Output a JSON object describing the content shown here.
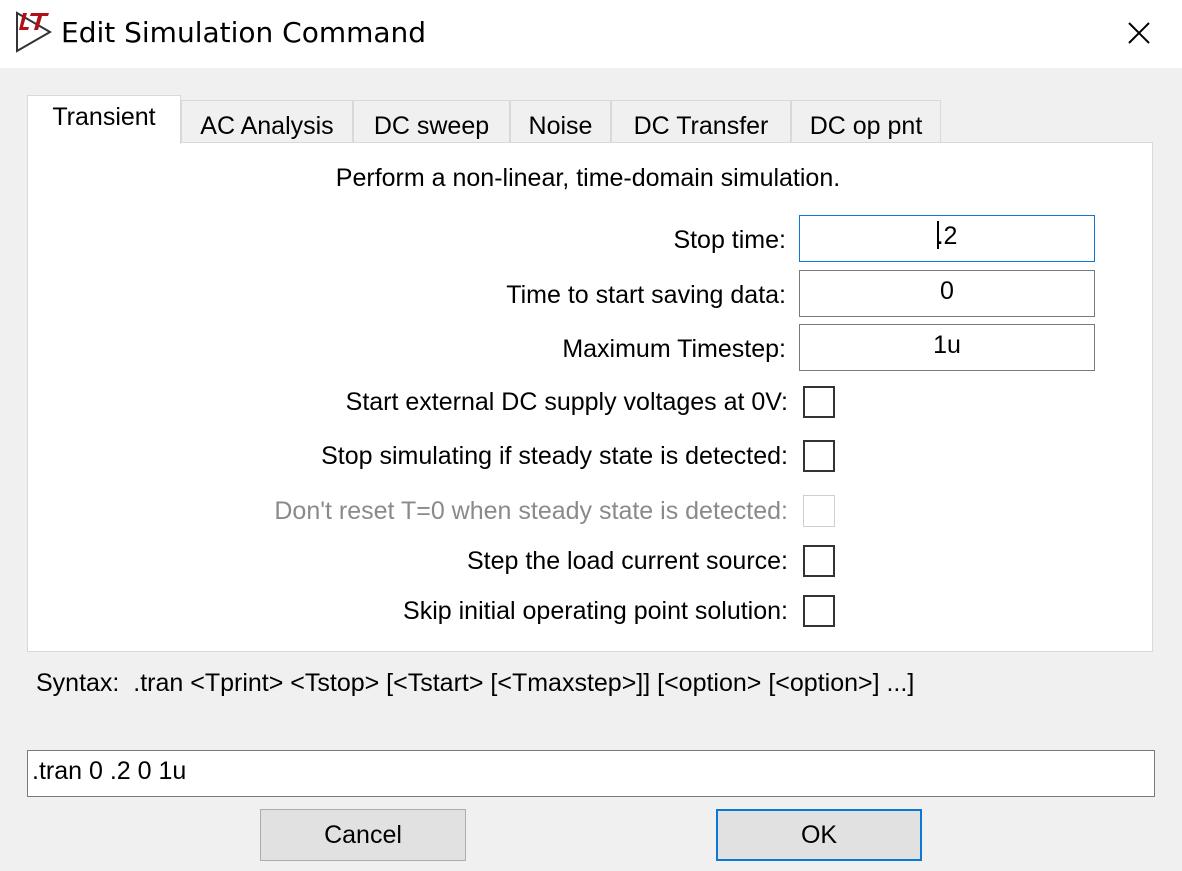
{
  "window": {
    "title": "Edit Simulation Command",
    "icon": "ltspice-logo-icon",
    "close_icon": "close-icon"
  },
  "tabs": [
    {
      "label": "Transient",
      "active": true
    },
    {
      "label": "AC Analysis",
      "active": false
    },
    {
      "label": "DC sweep",
      "active": false
    },
    {
      "label": "Noise",
      "active": false
    },
    {
      "label": "DC Transfer",
      "active": false
    },
    {
      "label": "DC op pnt",
      "active": false
    }
  ],
  "transient": {
    "description": "Perform a non-linear, time-domain simulation.",
    "fields": [
      {
        "label": "Stop time:",
        "value": ".2",
        "focused": true
      },
      {
        "label": "Time to start saving data:",
        "value": "0",
        "focused": false
      },
      {
        "label": "Maximum Timestep:",
        "value": "1u",
        "focused": false
      }
    ],
    "checkboxes": [
      {
        "label": "Start external DC supply voltages at 0V:",
        "checked": false,
        "enabled": true
      },
      {
        "label": "Stop simulating if steady state is detected:",
        "checked": false,
        "enabled": true
      },
      {
        "label": "Don't reset T=0 when steady state is detected:",
        "checked": false,
        "enabled": false
      },
      {
        "label": "Step the load current source:",
        "checked": false,
        "enabled": true
      },
      {
        "label": "Skip initial operating point solution:",
        "checked": false,
        "enabled": true
      }
    ]
  },
  "syntax": "Syntax:  .tran <Tprint> <Tstop> [<Tstart> [<Tmaxstep>]] [<option> [<option>] ...]",
  "command": ".tran 0 .2 0 1u",
  "buttons": {
    "cancel": "Cancel",
    "ok": "OK"
  },
  "colors": {
    "focus_border": "#0a78d4",
    "disabled_text": "#8a8a8a",
    "dialog_bg": "#f0f0f0",
    "logo_red": "#b01018"
  }
}
